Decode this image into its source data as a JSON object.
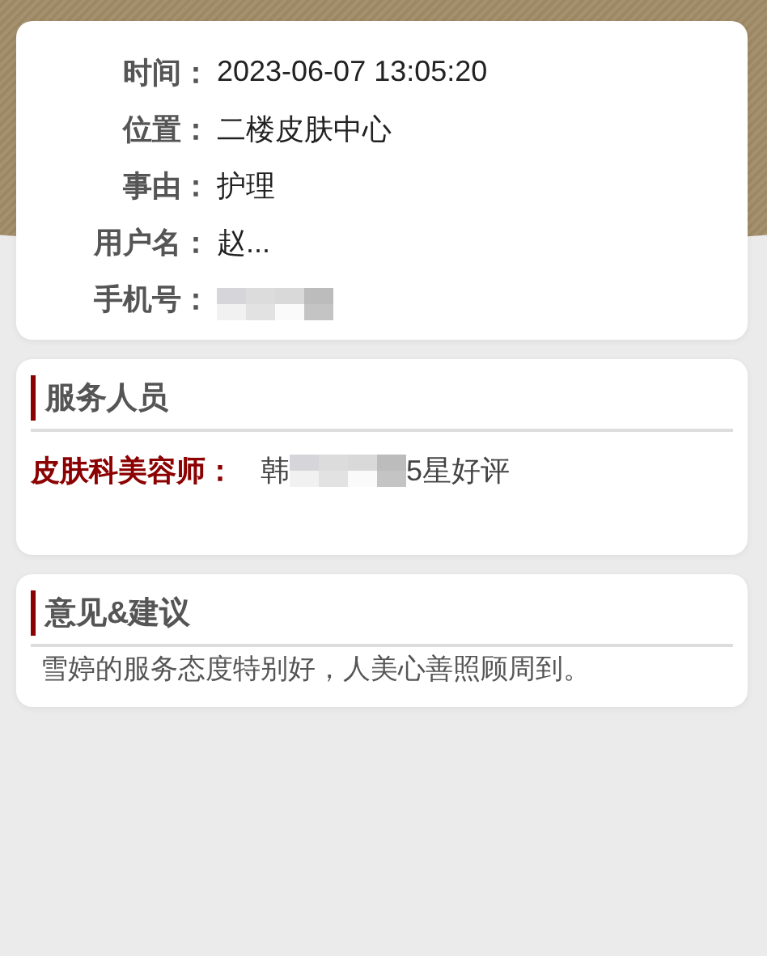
{
  "info": {
    "rows": [
      {
        "label": "时间：",
        "kind": "text",
        "value": "2023-06-07 13:05:20"
      },
      {
        "label": "位置：",
        "kind": "text",
        "value": "二楼皮肤中心"
      },
      {
        "label": "事由：",
        "kind": "text",
        "value": "护理"
      },
      {
        "label": "用户名：",
        "kind": "text",
        "value": "赵..."
      },
      {
        "label": "手机号：",
        "kind": "redacted"
      }
    ]
  },
  "staff": {
    "title": "服务人员",
    "role": "皮肤科美容师：",
    "name": "韩",
    "redacted": true,
    "rating": "5星好评"
  },
  "feedback": {
    "title": "意见&建议",
    "text": "雪婷的服务态度特别好，人美心善照顾周到。"
  }
}
